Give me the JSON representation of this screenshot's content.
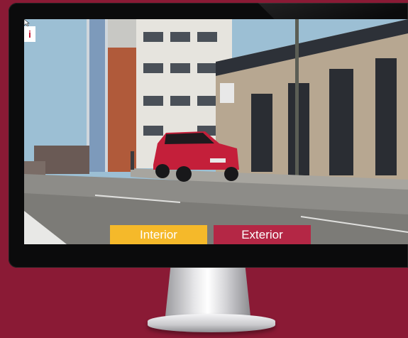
{
  "screen": {
    "info_badge": "i",
    "tabs": [
      {
        "label": "Interior",
        "color": "#f5b92a"
      },
      {
        "label": "Exterior",
        "color": "#b42745"
      }
    ]
  },
  "colors": {
    "background": "#8a1a35",
    "bezel": "#0b0b0c",
    "car": "#c41f3a"
  }
}
